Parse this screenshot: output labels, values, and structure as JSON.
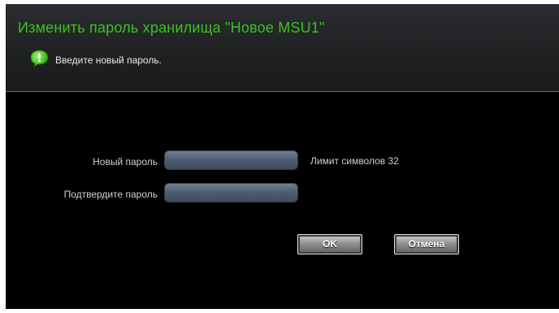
{
  "dialog": {
    "title": "Изменить пароль хранилища \"Новое MSU1\"",
    "hint": "Введите новый пароль.",
    "hint_icon": "info-bubble-icon"
  },
  "form": {
    "new_password_label": "Новый пароль",
    "confirm_password_label": "Подтвердите пароль",
    "new_password_value": "",
    "confirm_password_value": "",
    "limit_text": "Лимит символов 32"
  },
  "buttons": {
    "ok_label": "OK",
    "cancel_label": "Отмена"
  },
  "colors": {
    "title": "#39c21f",
    "icon": "#4cc62a",
    "background": "#000000"
  }
}
